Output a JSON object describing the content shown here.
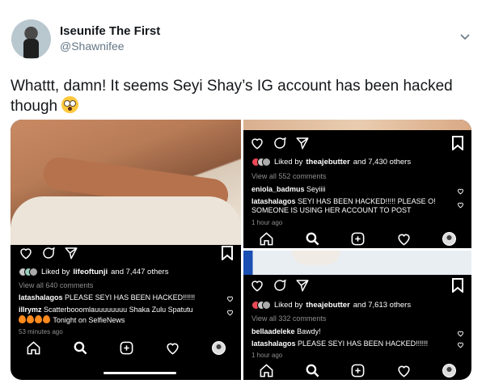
{
  "author": {
    "name": "Iseunife The First",
    "handle": "@Shawnifee"
  },
  "tweet": {
    "text": "Whattt, damn! It seems Seyi Shay’s IG account has been hacked though"
  },
  "icons": {
    "menu": "chevron-down-icon",
    "emoji": "flushed-face-emoji"
  },
  "panels": {
    "left": {
      "liked_by_prefix": "Liked by",
      "liked_by_user": "lifeoftunji",
      "liked_by_suffix": "and 7,447 others",
      "view_all": "View all 640 comments",
      "comments": [
        {
          "user": "latashalagos",
          "text": "PLEASE SEYI HAS BEEN HACKED!!!!!!"
        },
        {
          "user": "illrymz",
          "text": "Scatterbooomlauuuuuuuu Shaka Zulu Spatutu",
          "text2": "Tonight on SelfieNews"
        }
      ],
      "time": "53 minutes ago"
    },
    "top_right": {
      "liked_by_prefix": "Liked by",
      "liked_by_user": "theajebutter",
      "liked_by_suffix": "and 7,430 others",
      "view_all": "View all 552 comments",
      "comments": [
        {
          "user": "eniola_badmus",
          "text": "Seyiiii"
        },
        {
          "user": "latashalagos",
          "text": "SEYI HAS BEEN HACKED!!!!! PLEASE O!",
          "text2": "SOMEONE IS USING HER ACCOUNT TO POST"
        }
      ],
      "time": "1 hour ago"
    },
    "bottom_right": {
      "liked_by_prefix": "Liked by",
      "liked_by_user": "theajebutter",
      "liked_by_suffix": "and 7,613 others",
      "view_all": "View all 332 comments",
      "comments": [
        {
          "user": "bellaadeleke",
          "text": "Bawdy!"
        },
        {
          "user": "latashalagos",
          "text": "PLEASE SEYI HAS BEEN HACKED!!!!!!"
        }
      ],
      "time": "1 hour ago"
    }
  },
  "colors": {
    "text": "#14171a",
    "muted": "#657786",
    "ig_bg": "#000000",
    "ig_grey": "#8e8e8e",
    "notif_red": "#ed4956"
  }
}
